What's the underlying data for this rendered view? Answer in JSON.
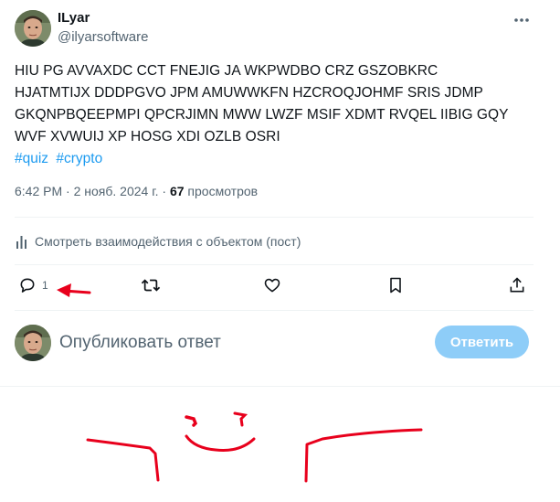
{
  "author": {
    "name": "ILyar",
    "handle": "@ilyarsoftware"
  },
  "post": {
    "text": "HIU PG AVVAXDC CCT FNEJIG JA WKPWDBO CRZ GSZOBKRC\nHJATMTIJX DDDPGVO JPM AMUWWKFN HZCROQJOHMF SRIS JDMP\nGKQNPBQEEPMPI QPCRJIMN MWW LWZF MSIF XDMT RVQEL IIBIG GQY\nWVF XVWUIJ XP HOSG XDI OZLB OSRI",
    "hashtags": [
      "#quiz",
      "#crypto"
    ],
    "time": "6:42 PM",
    "date": "2 нояб. 2024 г.",
    "separator": "·",
    "views_count": "67",
    "views_label": "просмотров"
  },
  "analytics": {
    "label": "Смотреть взаимодействия с объектом (пост)"
  },
  "actions": {
    "reply_count": "1"
  },
  "reply": {
    "placeholder": "Опубликовать ответ",
    "button_label": "Ответить"
  },
  "colors": {
    "accent": "#1d9bf0",
    "reply_button": "#8ecdf8",
    "secondary_text": "#536471",
    "annotation_ink": "#e8001c"
  },
  "icons": {
    "more": "more-dots-icon",
    "analytics": "bar-chart-icon",
    "reply": "comment-bubble-icon",
    "repost": "repost-arrows-icon",
    "like": "heart-icon",
    "bookmark": "bookmark-icon",
    "share": "share-upload-icon"
  }
}
